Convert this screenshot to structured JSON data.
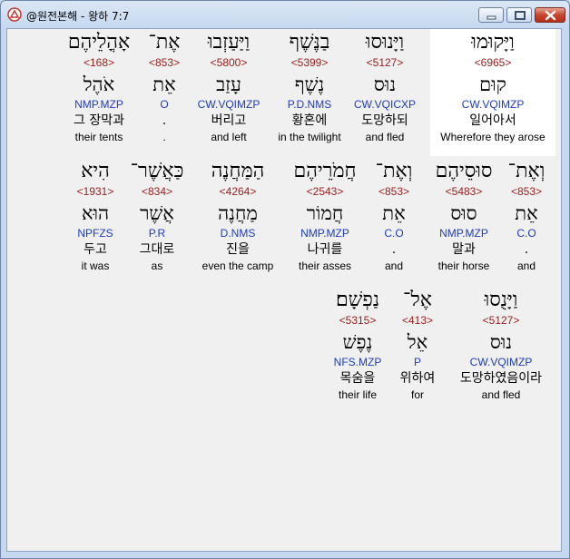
{
  "window": {
    "title": "@원전본해 - 왕하 7:7"
  },
  "words": [
    {
      "hebrew": "וַיָּקוּמוּ",
      "strong": "<6965>",
      "lemma": "קוּם",
      "parse": "CW.VQIMZP",
      "korean": "일어아서",
      "english": "Wherefore they arose",
      "highlighted": true
    },
    {
      "hebrew": "וַיָּנוּסוּ",
      "strong": "<5127>",
      "lemma": "נוּס",
      "parse": "CW.VQICXP",
      "korean": "도망하되",
      "english": "and fled"
    },
    {
      "hebrew": "בַנֶּשֶׁף",
      "strong": "<5399>",
      "lemma": "נֶשֶׁף",
      "parse": "P.D.NMS",
      "korean": "황혼에",
      "english": "in the twilight"
    },
    {
      "hebrew": "וַיַּעַזְבוּ",
      "strong": "<5800>",
      "lemma": "עָזַב",
      "parse": "CW.VQIMZP",
      "korean": "버리고",
      "english": "and left"
    },
    {
      "hebrew": "אֶת־",
      "strong": "<853>",
      "lemma": "אֵת",
      "parse": "O",
      "korean": ".",
      "english": "."
    },
    {
      "hebrew": "אָהֳלֵיהֶם",
      "strong": "<168>",
      "lemma": "אֹהֶל",
      "parse": "NMP.MZP",
      "korean": "그 장막과",
      "english": "their tents"
    },
    {
      "hebrew": "וְאֶת־",
      "strong": "<853>",
      "lemma": "אֵת",
      "parse": "C.O",
      "korean": ".",
      "english": "and"
    },
    {
      "hebrew": "סוּסֵיהֶם",
      "strong": "<5483>",
      "lemma": "סוּס",
      "parse": "NMP.MZP",
      "korean": "말과",
      "english": "their horse"
    },
    {
      "hebrew": "וְאֶת־",
      "strong": "<853>",
      "lemma": "אֵת",
      "parse": "C.O",
      "korean": ".",
      "english": "and"
    },
    {
      "hebrew": "חֲמֹרֵיהֶם",
      "strong": "<2543>",
      "lemma": "חֲמוֹר",
      "parse": "NMP.MZP",
      "korean": "나귀를",
      "english": "their asses"
    },
    {
      "hebrew": "הַמַּחֲנֶה",
      "strong": "<4264>",
      "lemma": "מַחֲנֶה",
      "parse": "D.NMS",
      "korean": "진을",
      "english": "even the camp"
    },
    {
      "hebrew": "כַּאֲשֶׁר־",
      "strong": "<834>",
      "lemma": "אֲשֶׁר",
      "parse": "P.R",
      "korean": "그대로",
      "english": "as"
    },
    {
      "hebrew": "הִיא",
      "strong": "<1931>",
      "lemma": "הוּא",
      "parse": "NPFZS",
      "korean": "두고",
      "english": "it was"
    },
    {
      "hebrew": "וַיָּנֻסוּ",
      "strong": "<5127>",
      "lemma": "נוּס",
      "parse": "CW.VQIMZP",
      "korean": "도망하였음이라",
      "english": "and fled"
    },
    {
      "hebrew": "אֶל־",
      "strong": "<413>",
      "lemma": "אֵל",
      "parse": "P",
      "korean": "위하여",
      "english": "for"
    },
    {
      "hebrew": "נַפְשָׁם׃",
      "strong": "<5315>",
      "lemma": "נֶפֶשׁ",
      "parse": "NFS.MZP",
      "korean": "목숨을",
      "english": "their life"
    }
  ]
}
